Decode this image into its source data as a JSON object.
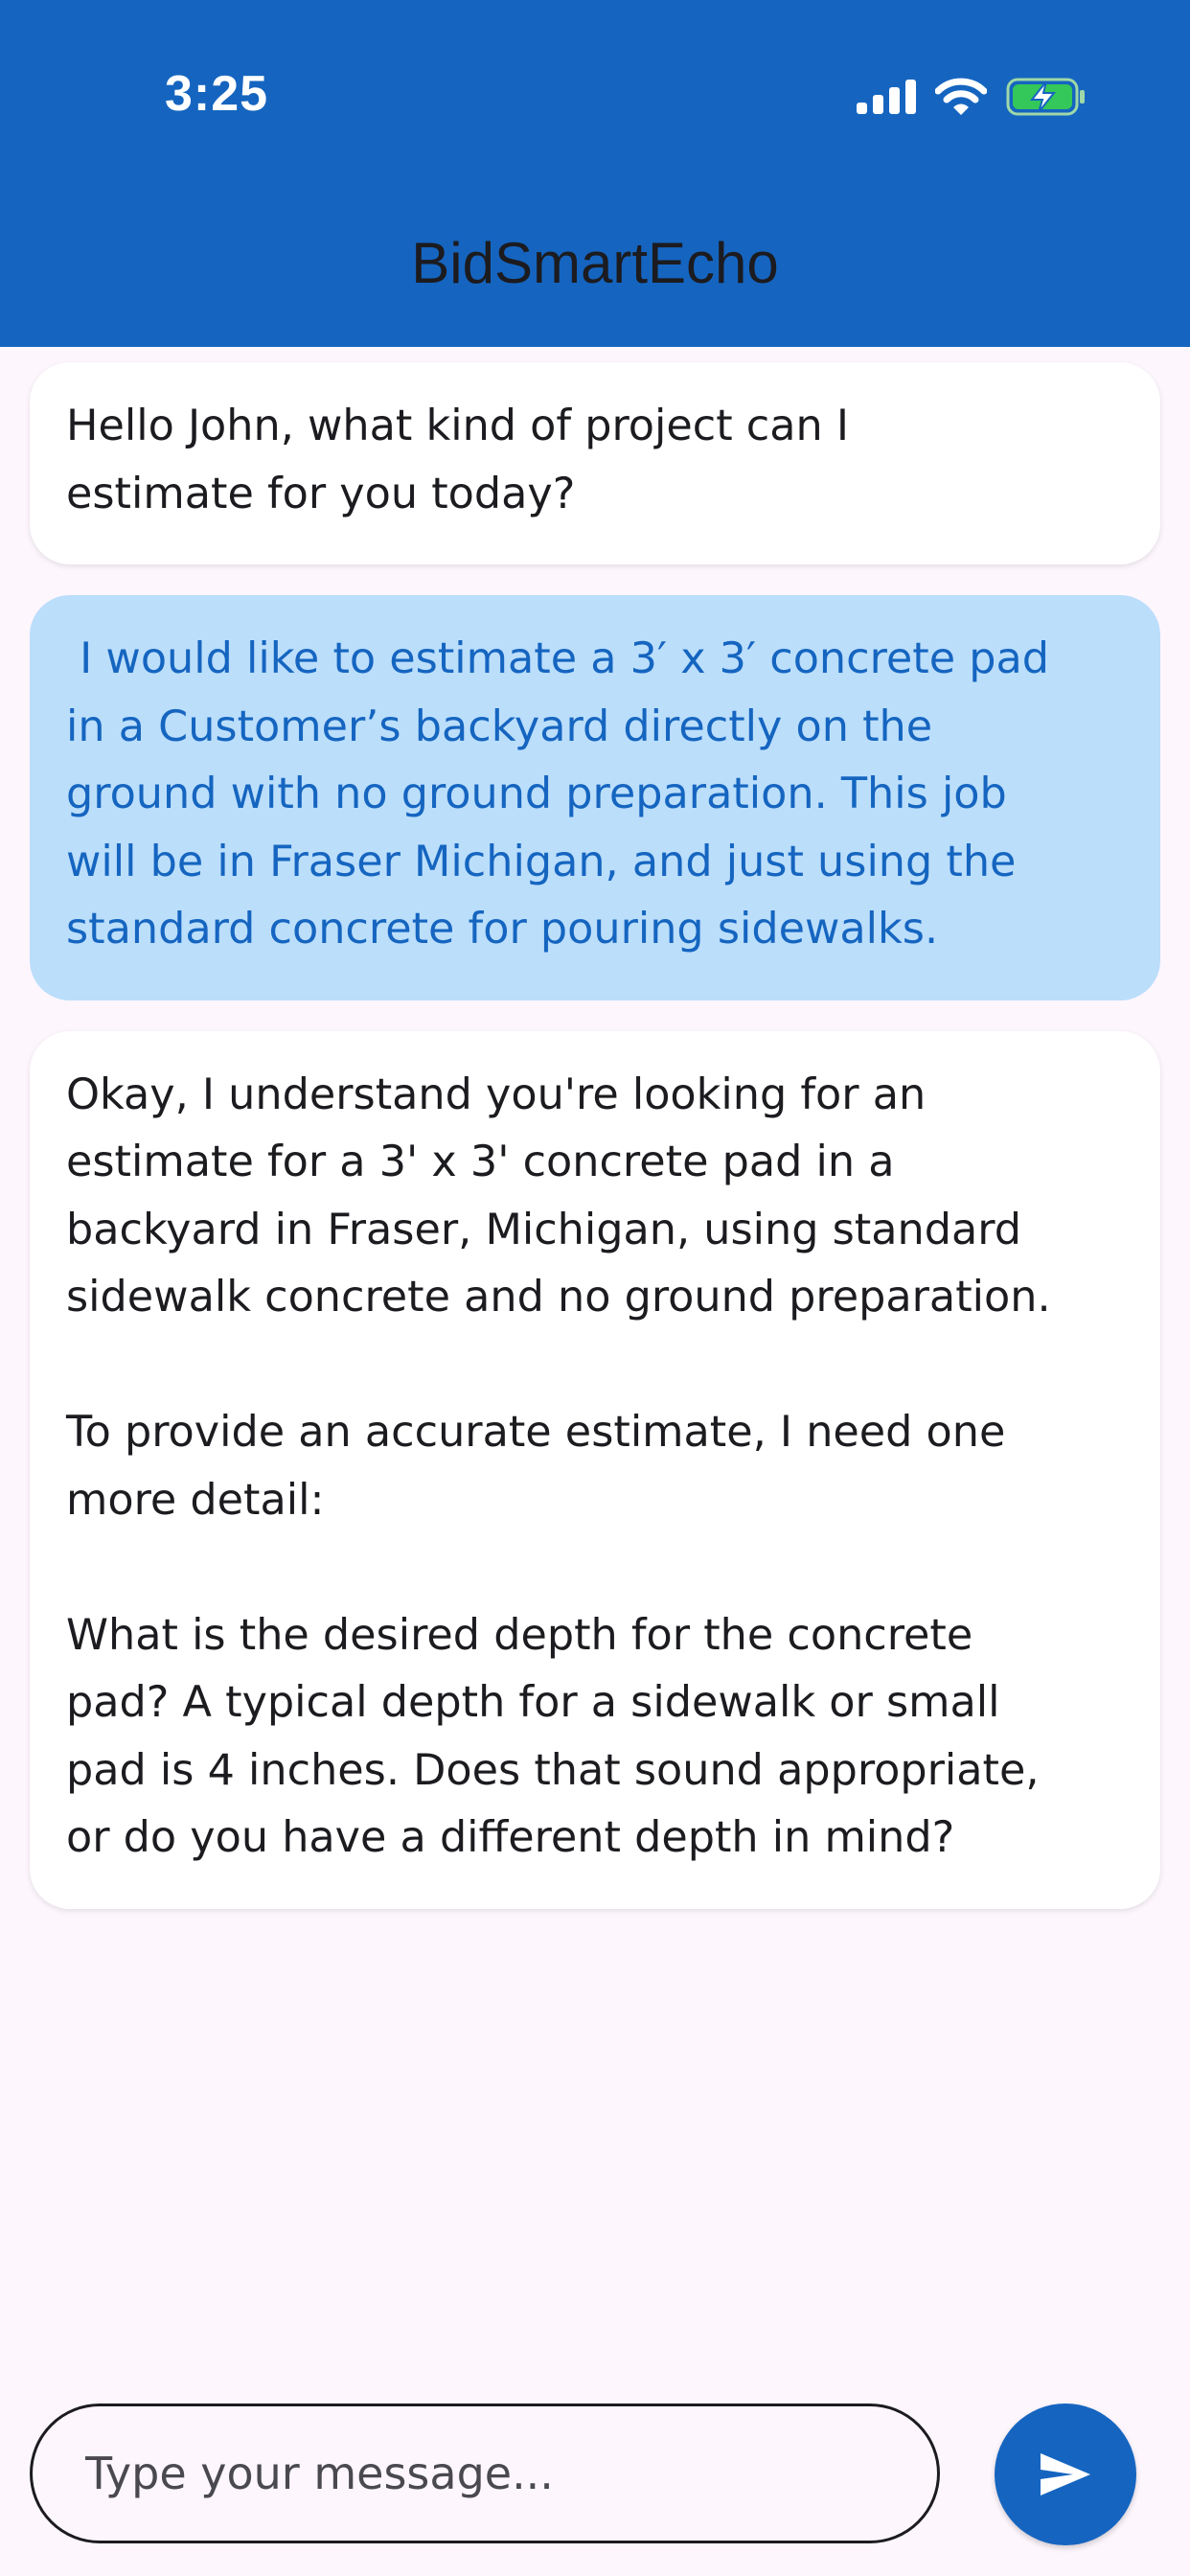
{
  "status_bar": {
    "time": "3:25",
    "icons": [
      "signal-icon",
      "wifi-icon",
      "battery-charging-icon"
    ]
  },
  "app_bar": {
    "title": "BidSmartEcho"
  },
  "colors": {
    "primary": "#1565c0",
    "user_bubble": "#bbdefb",
    "background": "#fdf6fd",
    "battery_green": "#34c759"
  },
  "messages": [
    {
      "sender": "bot",
      "text": "Hello John, what kind of project can I\nestimate for you today?"
    },
    {
      "sender": "user",
      "text": " I would like to estimate a 3′ x 3′ concrete pad\nin a Customer’s backyard directly on the\nground with no ground preparation. This job\nwill be in Fraser Michigan, and just using the\nstandard concrete for pouring sidewalks."
    },
    {
      "sender": "bot",
      "text": "Okay, I understand you're looking for an\nestimate for a 3' x 3' concrete pad in a\nbackyard in Fraser, Michigan, using standard\nsidewalk concrete and no ground preparation.\n\nTo provide an accurate estimate, I need one\nmore detail:\n\nWhat is the desired depth for the concrete\npad? A typical depth for a sidewalk or small\npad is 4 inches. Does that sound appropriate,\nor do you have a different depth in mind?"
    }
  ],
  "composer": {
    "placeholder": "Type your message...",
    "value": "",
    "send_icon": "send-icon"
  }
}
